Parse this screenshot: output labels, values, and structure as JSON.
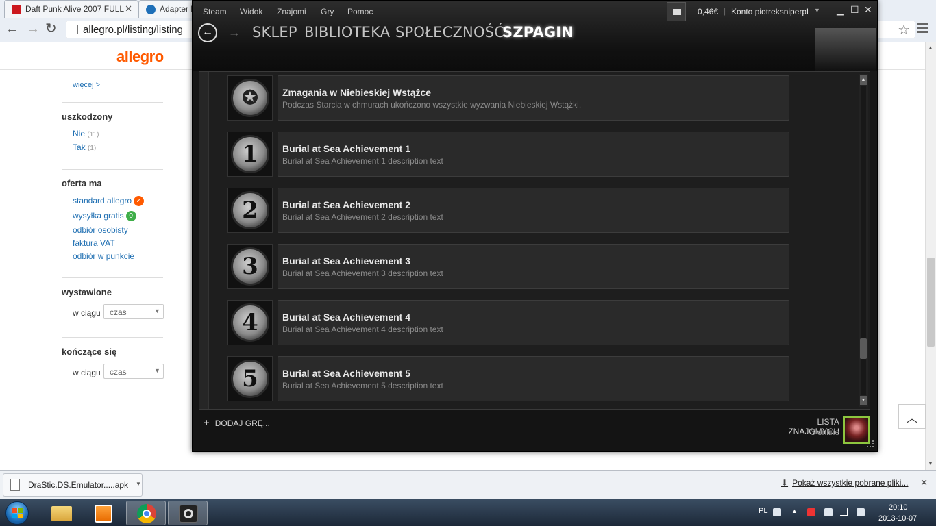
{
  "chrome": {
    "tabs": [
      {
        "title": "Daft Punk Alive 2007 FULL",
        "favicon_color": "#cc181e"
      },
      {
        "title": "Adapter k",
        "favicon_color": "#1e6fb8"
      }
    ],
    "url": "allegro.pl/listing/listing",
    "download": {
      "file": "DraStic.DS.Emulator.....apk",
      "show_all": "Pokaż wszystkie pobrane pliki..."
    }
  },
  "allegro": {
    "logo": "allegro",
    "more_link": "więcej >",
    "sections": {
      "damaged": {
        "heading": "uszkodzony",
        "items": [
          {
            "label": "Nie",
            "count": "(11)"
          },
          {
            "label": "Tak",
            "count": "(1)"
          }
        ]
      },
      "offer": {
        "heading": "oferta ma",
        "items": [
          "standard allegro",
          "wysyłka gratis",
          "odbiór osobisty",
          "faktura VAT",
          "odbiór w punkcie"
        ]
      },
      "listed": {
        "heading": "wystawione",
        "label": "w ciągu",
        "select": "czas"
      },
      "ending": {
        "heading": "kończące się",
        "label": "w ciągu",
        "select": "czas"
      }
    },
    "brand_color": "#ff5a00",
    "link_color": "#1f6fb2"
  },
  "steam": {
    "menu": [
      "Steam",
      "Widok",
      "Znajomi",
      "Gry",
      "Pomoc"
    ],
    "wallet": "0,46€",
    "separator": "|",
    "account": "Konto piotreksniperpl",
    "nav": [
      "SKLEP",
      "BIBLIOTEKA",
      "SPOŁECZNOŚĆ",
      "SZPAGIN"
    ],
    "active_nav": "SZPAGIN",
    "achievements": [
      {
        "title": "Zmagania w Niebieskiej Wstążce",
        "desc": "Podczas Starcia w chmurach ukończono wszystkie wyzwania Niebieskiej Wstążki.",
        "icon": "ribbon-medal-icon",
        "glyph": "✪"
      },
      {
        "title": "Burial at Sea Achievement 1",
        "desc": "Burial at Sea Achievement 1 description text",
        "icon": "number-1-medal-icon",
        "glyph": "1"
      },
      {
        "title": "Burial at Sea Achievement 2",
        "desc": "Burial at Sea Achievement 2 description text",
        "icon": "number-2-medal-icon",
        "glyph": "2"
      },
      {
        "title": "Burial at Sea Achievement 3",
        "desc": "Burial at Sea Achievement 3 description text",
        "icon": "number-3-medal-icon",
        "glyph": "3"
      },
      {
        "title": "Burial at Sea Achievement 4",
        "desc": "Burial at Sea Achievement 4 description text",
        "icon": "number-4-medal-icon",
        "glyph": "4"
      },
      {
        "title": "Burial at Sea Achievement 5",
        "desc": "Burial at Sea Achievement 5 description text",
        "icon": "number-5-medal-icon",
        "glyph": "5"
      }
    ],
    "footer": {
      "add_game": "DODAJ GRĘ...",
      "friends_list": "LISTA ZNAJOMYCH",
      "online": "3 online"
    }
  },
  "taskbar": {
    "lang": "PL",
    "time": "20:10",
    "date": "2013-10-07"
  }
}
